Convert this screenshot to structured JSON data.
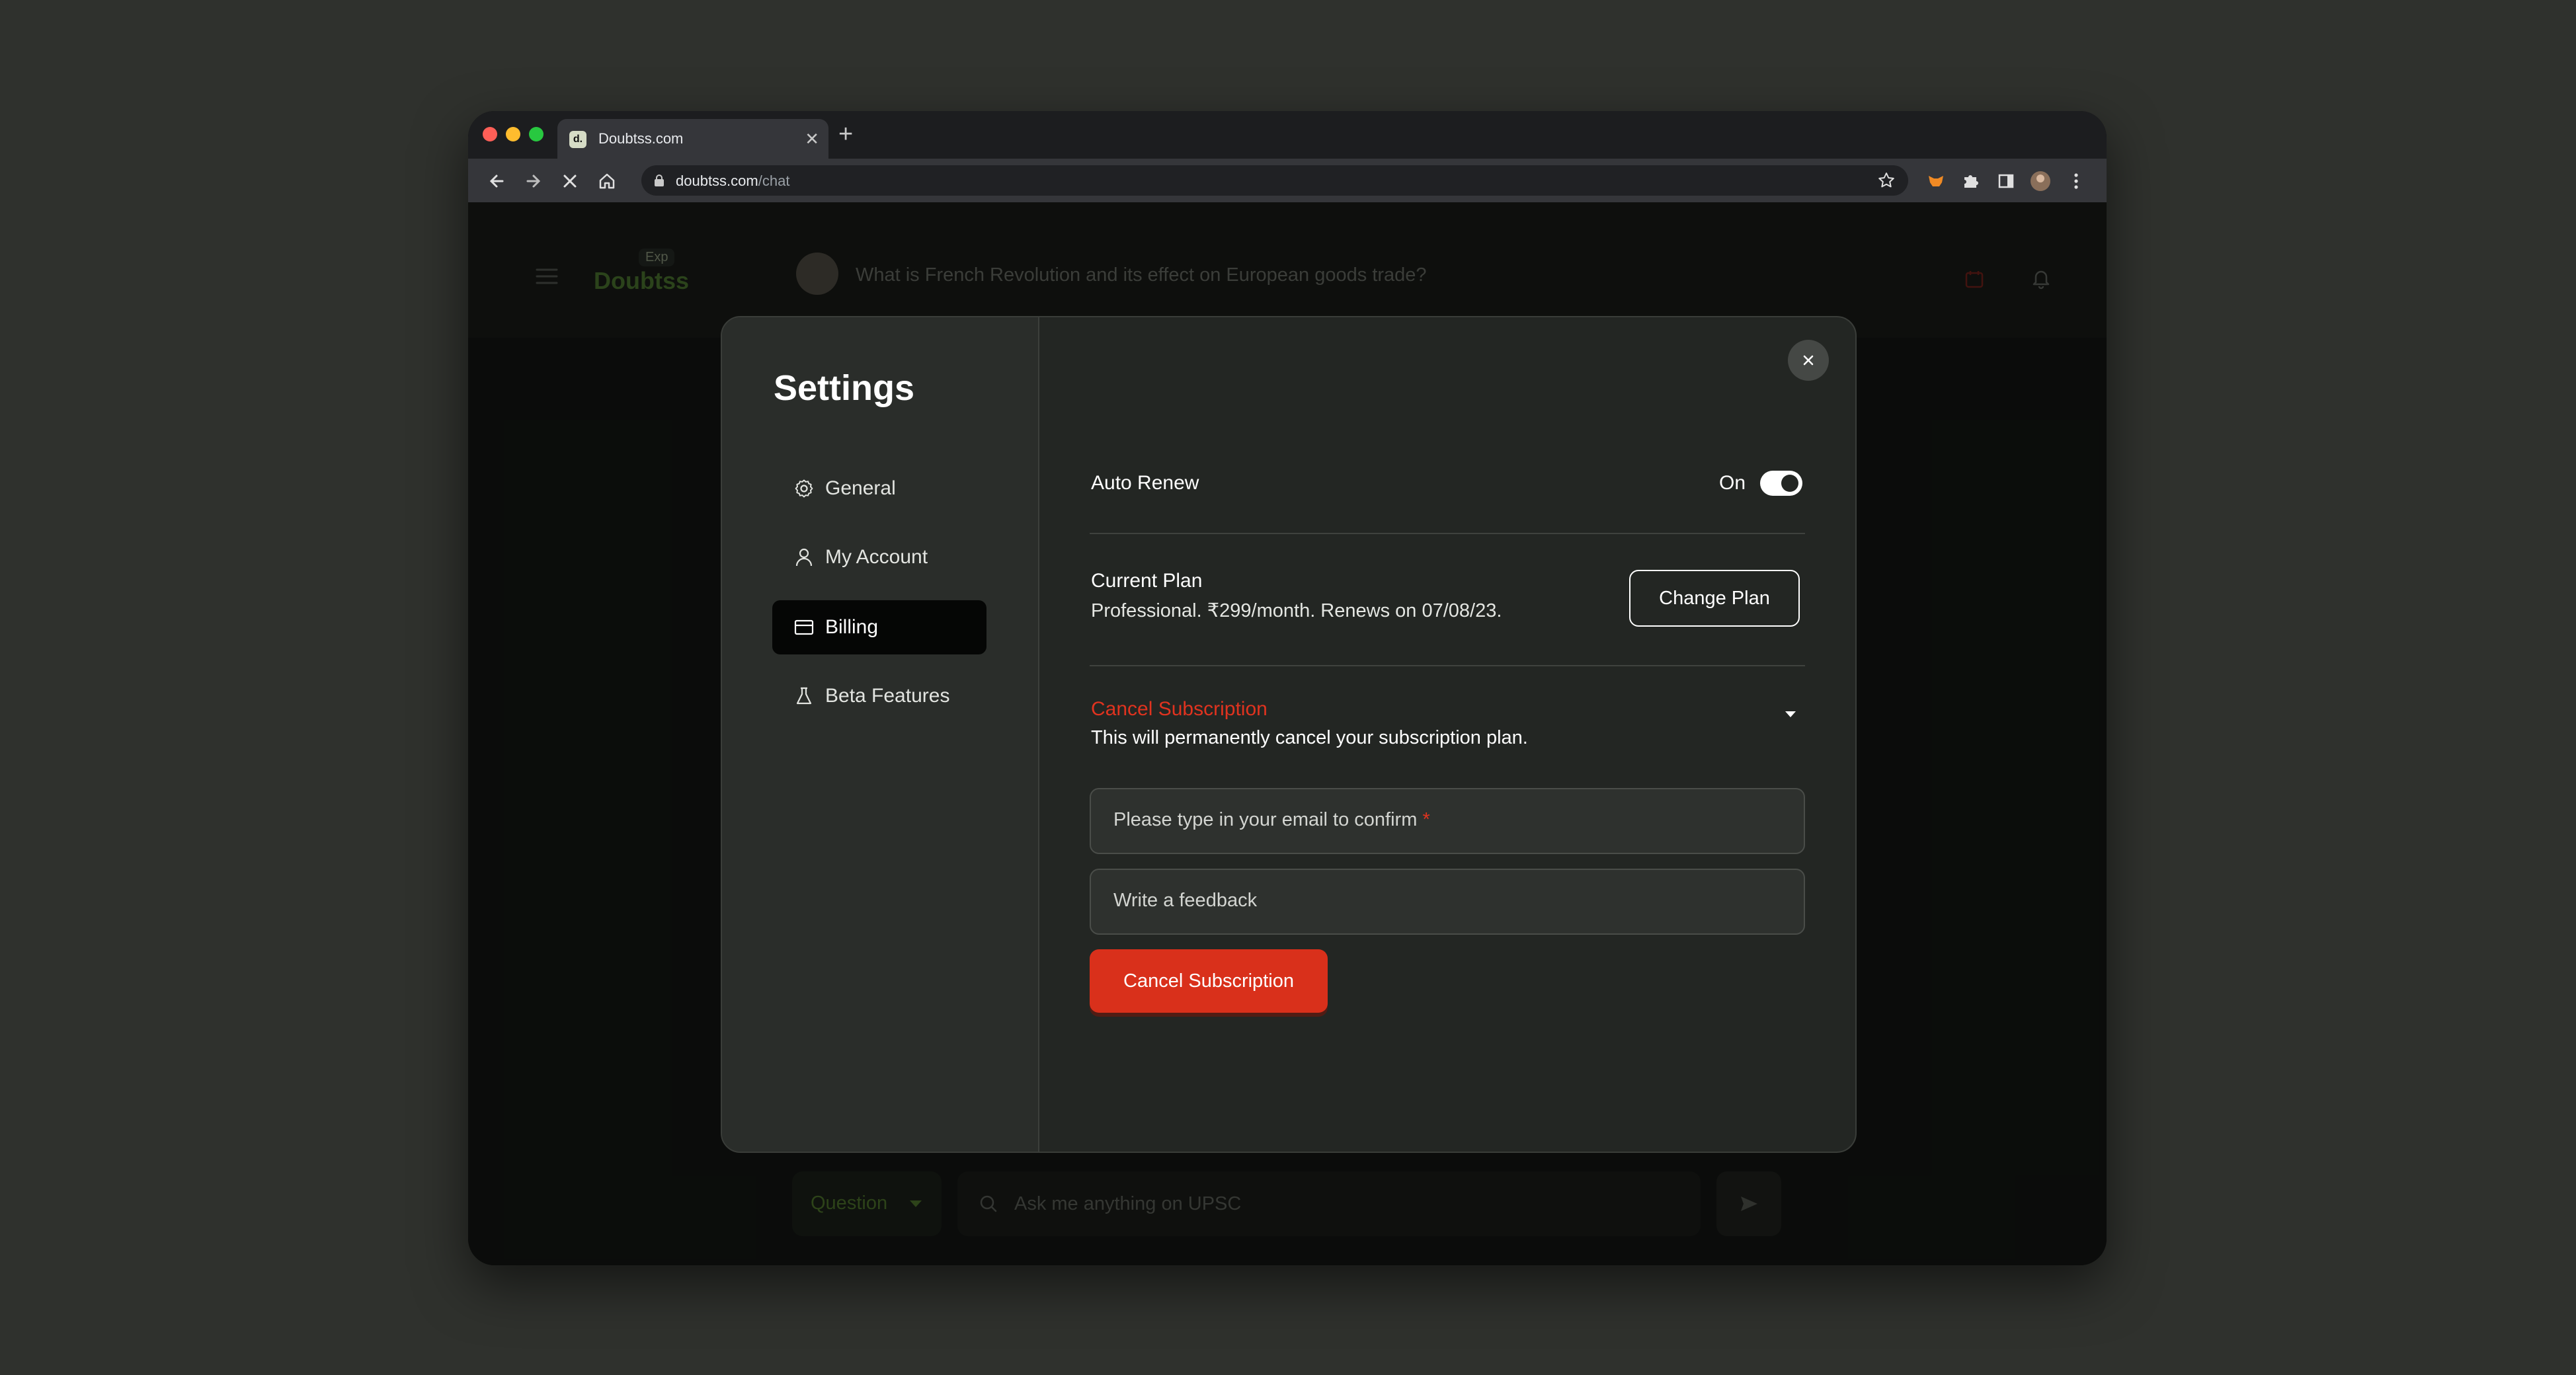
{
  "browser": {
    "tab_title": "Doubtss.com",
    "favicon_text": "d.",
    "url_host": "doubtss.com",
    "url_path": "/chat"
  },
  "app": {
    "logo_badge": "Exp",
    "logo_text": "Doubtss",
    "header_question": "What is French Revolution and its effect on European goods trade?",
    "bottom": {
      "mode_label": "Question",
      "ask_placeholder": "Ask me anything on UPSC"
    }
  },
  "settings": {
    "title": "Settings",
    "nav": [
      {
        "label": "General",
        "icon": "gear-icon"
      },
      {
        "label": "My Account",
        "icon": "user-icon"
      },
      {
        "label": "Billing",
        "icon": "card-icon",
        "active": true
      },
      {
        "label": "Beta Features",
        "icon": "flask-icon"
      }
    ],
    "auto_renew": {
      "label": "Auto Renew",
      "state_text": "On"
    },
    "current_plan": {
      "label": "Current Plan",
      "details": "Professional. ₹299/month. Renews on 07/08/23.",
      "button": "Change Plan"
    },
    "cancel": {
      "title": "Cancel Subscription",
      "description": "This will permanently cancel your subscription plan.",
      "email_placeholder": "Please type in your email to confirm",
      "required_mark": "*",
      "feedback_placeholder": "Write a feedback",
      "button": "Cancel Subscription"
    }
  },
  "colors": {
    "accent_danger": "#d9301b",
    "modal_bg": "#232623",
    "sidebar_bg": "#2a2d2a"
  }
}
